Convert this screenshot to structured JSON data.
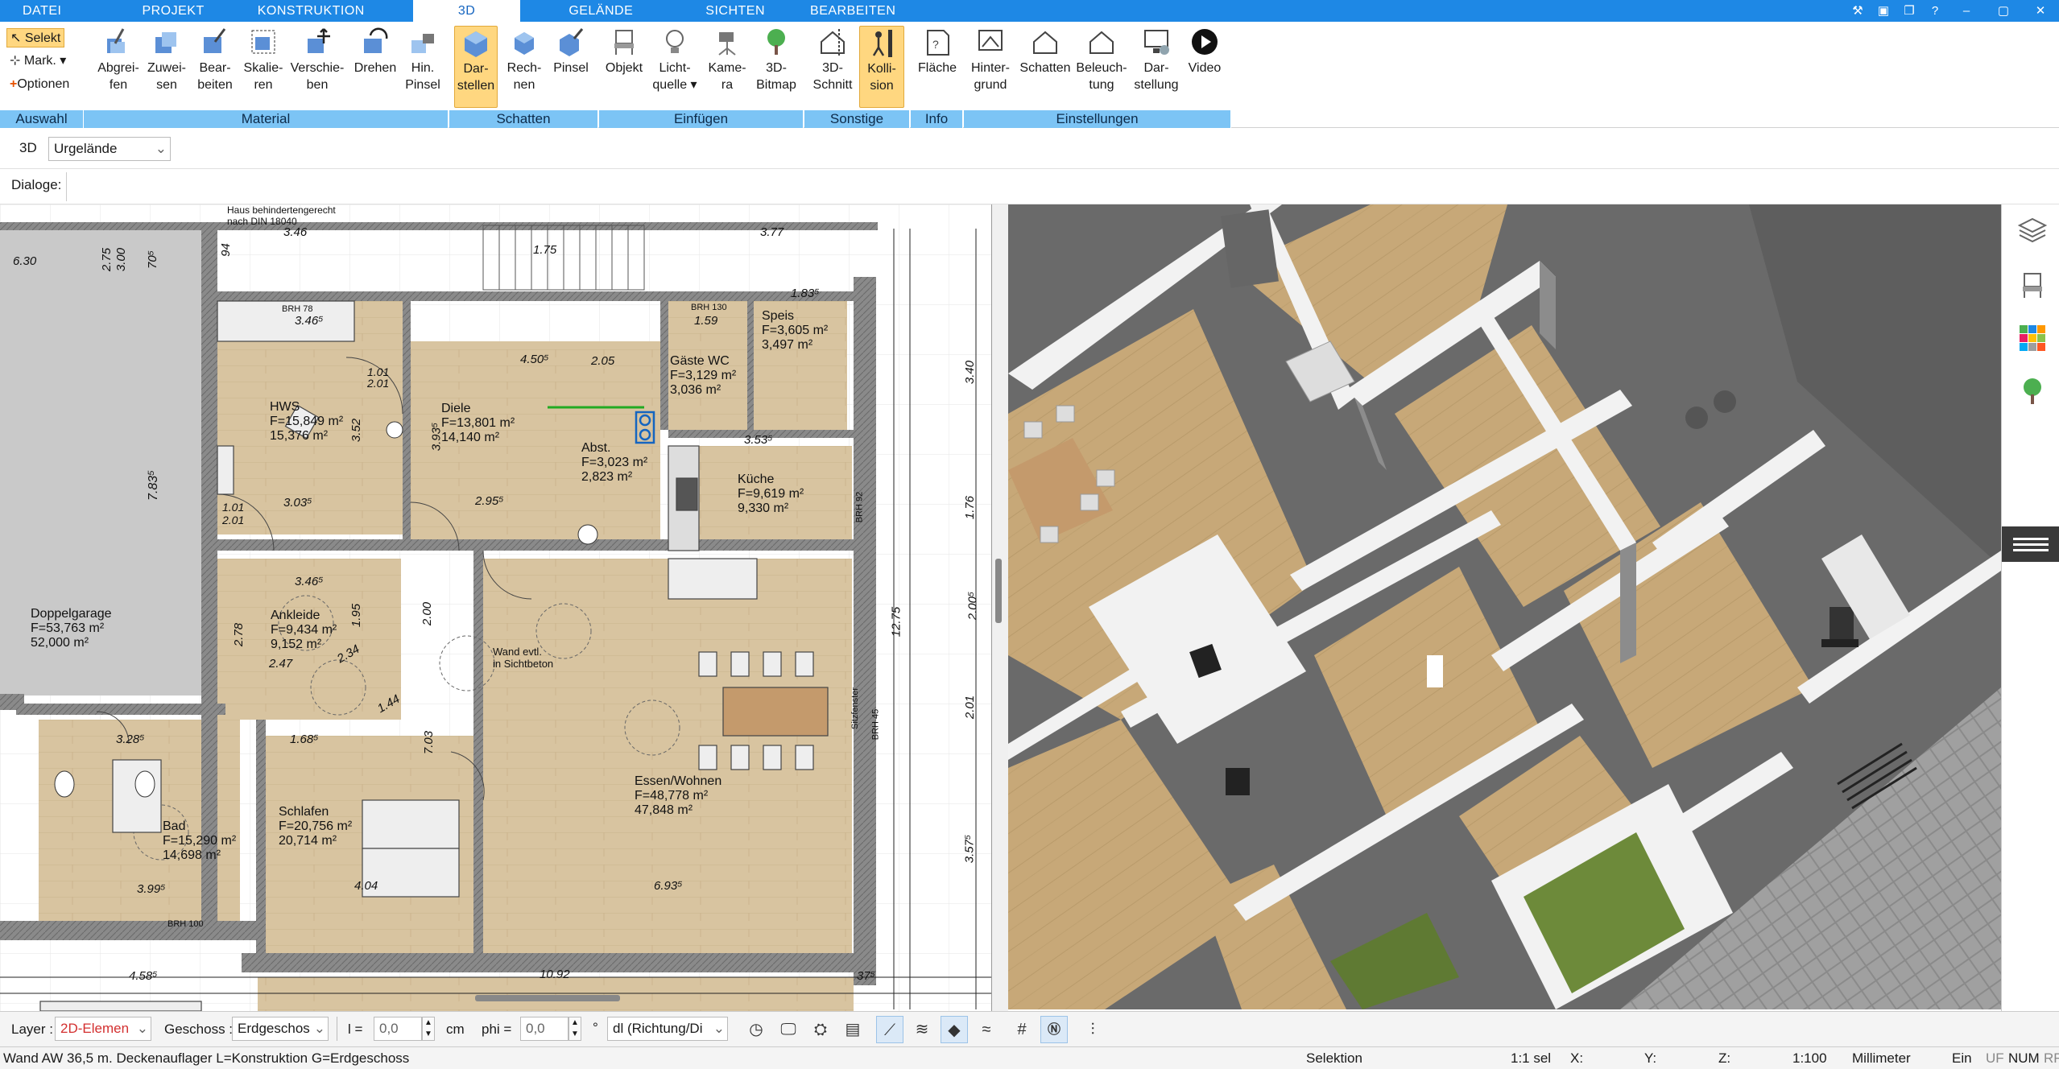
{
  "menu": {
    "tabs": [
      "DATEI",
      "PROJEKT",
      "KONSTRUKTION",
      "3D",
      "GELÄNDE",
      "SICHTEN",
      "BEARBEITEN"
    ],
    "active": "3D"
  },
  "ribbon": {
    "auswahl": {
      "caption": "Auswahl",
      "select": "Selekt",
      "mark": "Mark.",
      "options": "Optionen"
    },
    "material": {
      "caption": "Material",
      "buttons": [
        {
          "l1": "Abgrei-",
          "l2": "fen"
        },
        {
          "l1": "Zuwei-",
          "l2": "sen"
        },
        {
          "l1": "Bear-",
          "l2": "beiten"
        },
        {
          "l1": "Skalie-",
          "l2": "ren"
        },
        {
          "l1": "Verschie-",
          "l2": "ben"
        },
        {
          "l1": "Drehen",
          "l2": ""
        },
        {
          "l1": "Hin.",
          "l2": "Pinsel"
        }
      ]
    },
    "schatten": {
      "caption": "Schatten",
      "buttons": [
        {
          "l1": "Dar-",
          "l2": "stellen"
        },
        {
          "l1": "Rech-",
          "l2": "nen"
        },
        {
          "l1": "Pinsel",
          "l2": ""
        }
      ]
    },
    "einfuegen": {
      "caption": "Einfügen",
      "buttons": [
        {
          "l1": "Objekt",
          "l2": ""
        },
        {
          "l1": "Licht-",
          "l2": "quelle ▾"
        },
        {
          "l1": "Kame-",
          "l2": "ra"
        },
        {
          "l1": "3D-",
          "l2": "Bitmap"
        }
      ]
    },
    "sonstige": {
      "caption": "Sonstige",
      "buttons": [
        {
          "l1": "3D-",
          "l2": "Schnitt"
        },
        {
          "l1": "Kolli-",
          "l2": "sion"
        }
      ]
    },
    "info": {
      "caption": "Info",
      "buttons": [
        {
          "l1": "Fläche",
          "l2": ""
        }
      ]
    },
    "einstellungen": {
      "caption": "Einstellungen",
      "buttons": [
        {
          "l1": "Hinter-",
          "l2": "grund"
        },
        {
          "l1": "Schatten",
          "l2": ""
        },
        {
          "l1": "Beleuch-",
          "l2": "tung"
        },
        {
          "l1": "Dar-",
          "l2": "stellung"
        },
        {
          "l1": "Video",
          "l2": ""
        }
      ]
    }
  },
  "row3d": {
    "label": "3D",
    "dropdown": "Urgelände"
  },
  "rowdlg": {
    "label": "Dialoge:"
  },
  "plan": {
    "rooms": [
      {
        "name": "HWS",
        "area1": "F=15,849 m²",
        "area2": "15,376 m²"
      },
      {
        "name": "Diele",
        "area1": "F=13,801 m²",
        "area2": "14,140 m²"
      },
      {
        "name": "Küche",
        "area1": "F=9,619 m²",
        "area2": "9,330 m²"
      },
      {
        "name": "Speis",
        "area1": "F=3,605 m²",
        "area2": "3,497 m²"
      },
      {
        "name": "Gäste WC",
        "area1": "F=3,129 m²",
        "area2": "3,036 m²"
      },
      {
        "name": "Abst.",
        "area1": "F=3,023 m²",
        "area2": "2,823 m²"
      },
      {
        "name": "Doppelgarage",
        "area1": "F=53,763 m²",
        "area2": "52,000 m²"
      },
      {
        "name": "Ankleide",
        "area1": "F=9,434 m²",
        "area2": "9,152 m²"
      },
      {
        "name": "Essen/Wohnen",
        "area1": "F=48,778 m²",
        "area2": "47,848 m²"
      },
      {
        "name": "Schlafen",
        "area1": "F=20,756 m²",
        "area2": "20,714 m²"
      },
      {
        "name": "Bad",
        "area1": "F=15,290 m²",
        "area2": "14,698 m²"
      }
    ],
    "notes": [
      "Haus behindertengerecht",
      "nach DIN 18040",
      "Wand evtl.",
      "in Sichtbeton",
      "BRH 78",
      "BRH 100",
      "BRH 45",
      "BRH 92",
      "BRH 130",
      "Sitzfenster"
    ],
    "dims": [
      "3.46",
      "6.30",
      "2.75",
      "3.00",
      "70⁵",
      "94",
      "1.75",
      "3.77",
      "1.83⁵",
      "3.46⁵",
      "4.50⁵",
      "2.05",
      "1.59",
      "2.01",
      "1.01",
      "3.93⁵",
      "2.95⁵",
      "3.03⁵",
      "3.52",
      "7.83⁵",
      "1.01",
      "2.01",
      "3.53⁵",
      "3.40",
      "1.76",
      "2.00⁵",
      "12.75",
      "2.01",
      "3.57⁵",
      "3.46⁵",
      "2.78",
      "2.47",
      "1.95",
      "2.00",
      "1.44",
      "3.28⁵",
      "1.68⁵",
      "7.03",
      "4.04",
      "6.93⁵",
      "3.99⁵",
      "4.58⁵",
      "10.92",
      "37⁵",
      "2.34"
    ]
  },
  "layerbar": {
    "layer_label": "Layer :",
    "layer_value": "2D-Elemen",
    "geschoss_label": "Geschoss :",
    "geschoss_value": "Erdgeschos",
    "l_label": "l =",
    "l_value": "0,0",
    "unit": "cm",
    "phi_label": "phi =",
    "phi_value": "0,0",
    "deg": "°",
    "dl_value": "dl (Richtung/Di",
    "colors": {
      "layer_value": "#d32f2f"
    }
  },
  "statusbar": {
    "left": "Wand AW 36,5 m. Deckenauflager L=Konstruktion G=Erdgeschoss",
    "mode": "Selektion",
    "sel": "1:1 sel",
    "x": "X:",
    "y": "Y:",
    "z": "Z:",
    "scale": "1:100",
    "unit": "Millimeter",
    "flags": [
      "Ein",
      "UF",
      "NUM",
      "RF"
    ]
  },
  "colors": {
    "accent": "#1e88e5",
    "ribbon_caption": "#7cc4f5",
    "highlight": "#ffd780",
    "floor": "#dcc9a6",
    "wall": "#f4f4f4",
    "roof": "#5c5c5c"
  }
}
